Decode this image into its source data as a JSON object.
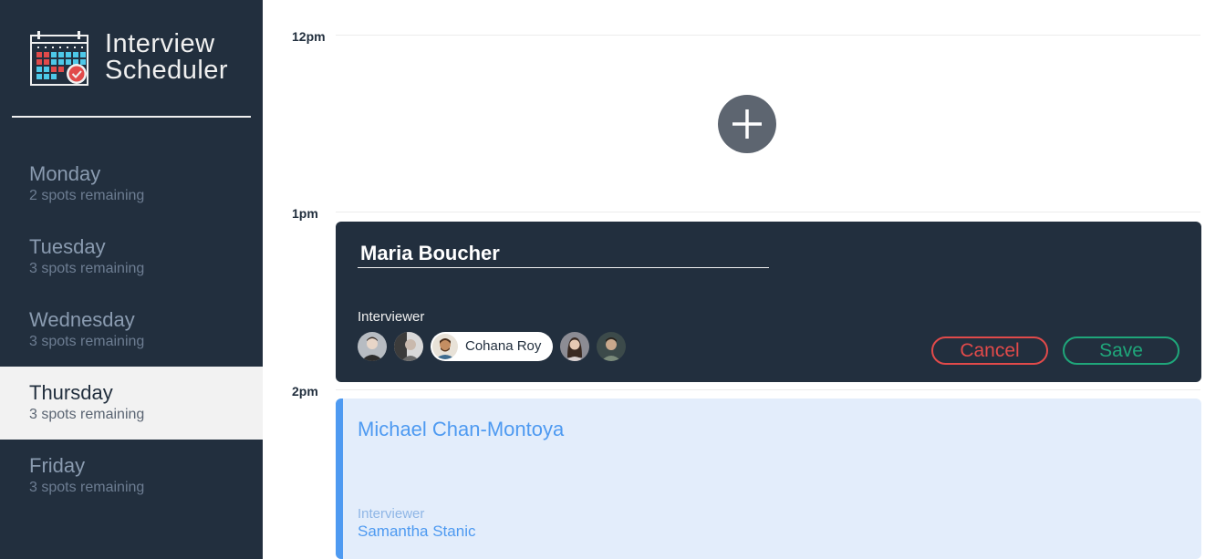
{
  "app": {
    "title_line1": "Interview",
    "title_line2": "Scheduler"
  },
  "sidebar": {
    "days": [
      {
        "name": "Monday",
        "spots": "2 spots remaining",
        "selected": false
      },
      {
        "name": "Tuesday",
        "spots": "3 spots remaining",
        "selected": false
      },
      {
        "name": "Wednesday",
        "spots": "3 spots remaining",
        "selected": false
      },
      {
        "name": "Thursday",
        "spots": "3 spots remaining",
        "selected": true
      },
      {
        "name": "Friday",
        "spots": "3 spots remaining",
        "selected": false
      }
    ]
  },
  "schedule": {
    "times": [
      "12pm",
      "1pm",
      "2pm"
    ],
    "add_icon": "plus-icon",
    "form": {
      "student_value": "Maria Boucher",
      "interviewer_label": "Interviewer",
      "selected_interviewer": "Cohana Roy",
      "cancel_label": "Cancel",
      "save_label": "Save"
    },
    "booked": {
      "student": "Michael Chan-Montoya",
      "interviewer_label": "Interviewer",
      "interviewer_name": "Samantha Stanic"
    }
  },
  "colors": {
    "sidebar_bg": "#222f3e",
    "selected_day_bg": "#f2f2f2",
    "cancel": "#e14a4a",
    "save": "#1fa67a",
    "booked_accent": "#4e9af1",
    "booked_bg": "#e3edfb"
  }
}
